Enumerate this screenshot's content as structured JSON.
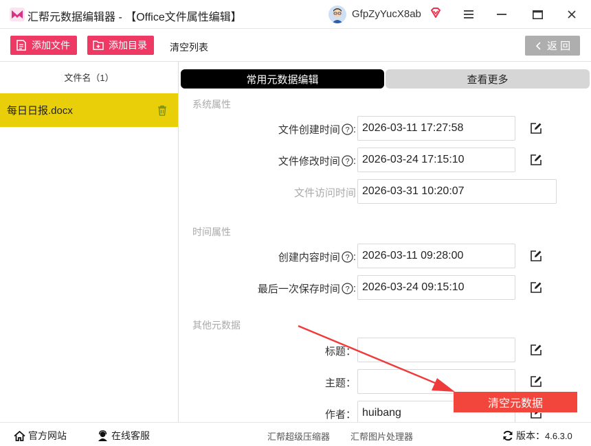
{
  "window": {
    "title": "汇帮元数据编辑器 - 【Office文件属性编辑】",
    "username": "GfpZyYucX8ab"
  },
  "toolbar": {
    "add_file": "添加文件",
    "add_dir": "添加目录",
    "clear_list": "清空列表",
    "back": "返 回"
  },
  "file_list": {
    "header": "文件名（1）",
    "items": [
      {
        "name": "每日日报.docx"
      }
    ]
  },
  "tabs": {
    "common": "常用元数据编辑",
    "more": "查看更多"
  },
  "sections": {
    "system": "系统属性",
    "time": "时间属性",
    "other": "其他元数据"
  },
  "fields": {
    "created": {
      "label": "文件创建时间",
      "value": "2026-03-11 17:27:58"
    },
    "modified": {
      "label": "文件修改时间",
      "value": "2026-03-24 17:15:10"
    },
    "accessed": {
      "label": "文件访问时间",
      "value": "2026-03-31 10:20:07"
    },
    "content_created": {
      "label": "创建内容时间",
      "value": "2026-03-11 09:28:00"
    },
    "last_saved": {
      "label": "最后一次保存时间",
      "value": "2026-03-24 09:15:10"
    },
    "title": {
      "label": "标题：",
      "value": ""
    },
    "subject": {
      "label": "主题：",
      "value": ""
    },
    "author": {
      "label": "作者：",
      "value": "huibang"
    }
  },
  "colon": ":",
  "clear_metadata": "清空元数据",
  "statusbar": {
    "website": "官方网站",
    "support": "在线客服",
    "compressor": "汇帮超级压缩器",
    "image_tool": "汇帮图片处理器",
    "version_label": "版本：",
    "version": "4.6.3.0"
  },
  "colors": {
    "accent_pink": "#ee3965",
    "selected_file": "#e8cf0a",
    "clear_button": "#f2453b"
  }
}
